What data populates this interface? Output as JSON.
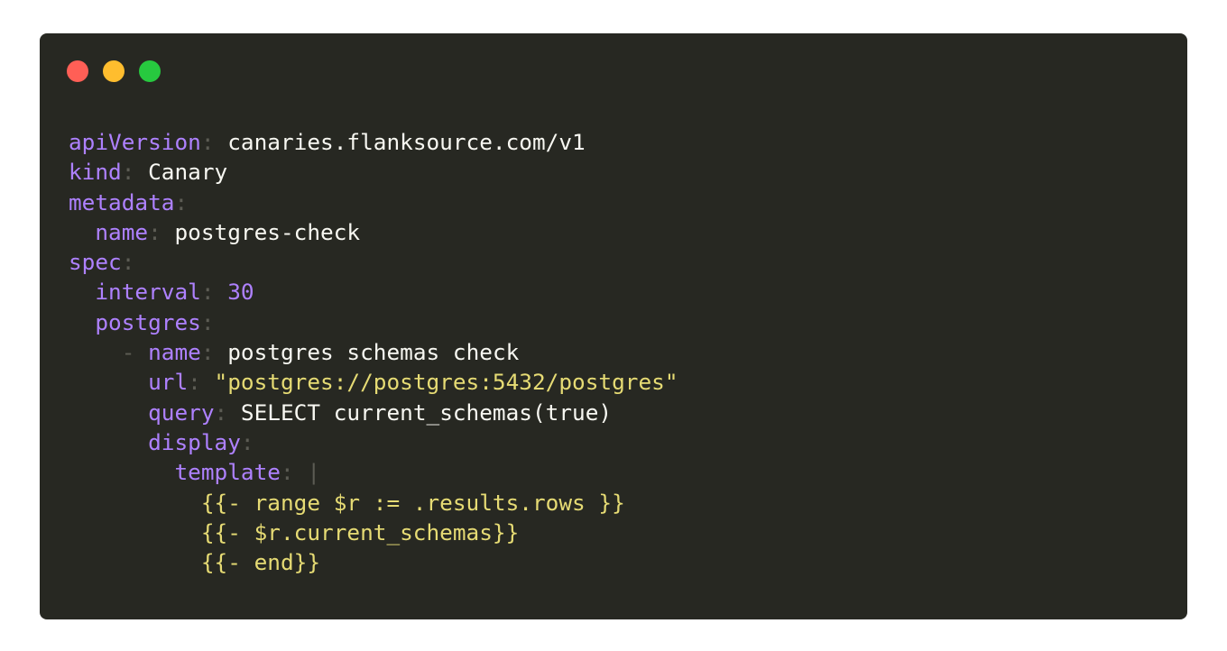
{
  "window": {
    "traffic_lights": {
      "close_color": "#ff5f56",
      "minimize_color": "#ffbd2e",
      "zoom_color": "#27c93f"
    },
    "background_color": "#272822"
  },
  "code": {
    "key_apiVersion": "apiVersion",
    "val_apiVersion": "canaries.flanksource.com/v1",
    "key_kind": "kind",
    "val_kind": "Canary",
    "key_metadata": "metadata",
    "key_name": "name",
    "val_name": "postgres-check",
    "key_spec": "spec",
    "key_interval": "interval",
    "val_interval": "30",
    "key_postgres": "postgres",
    "dash": "-",
    "key_item_name": "name",
    "val_item_name": "postgres schemas check",
    "key_url": "url",
    "val_url": "\"postgres://postgres:5432/postgres\"",
    "key_query": "query",
    "val_query": "SELECT current_schemas(true)",
    "key_display": "display",
    "key_template": "template",
    "block_indicator": "|",
    "template_line_1": "{{- range $r := .results.rows }}",
    "template_line_2": "{{- $r.current_schemas}}",
    "template_line_3": "{{- end}}",
    "colon": ":"
  }
}
